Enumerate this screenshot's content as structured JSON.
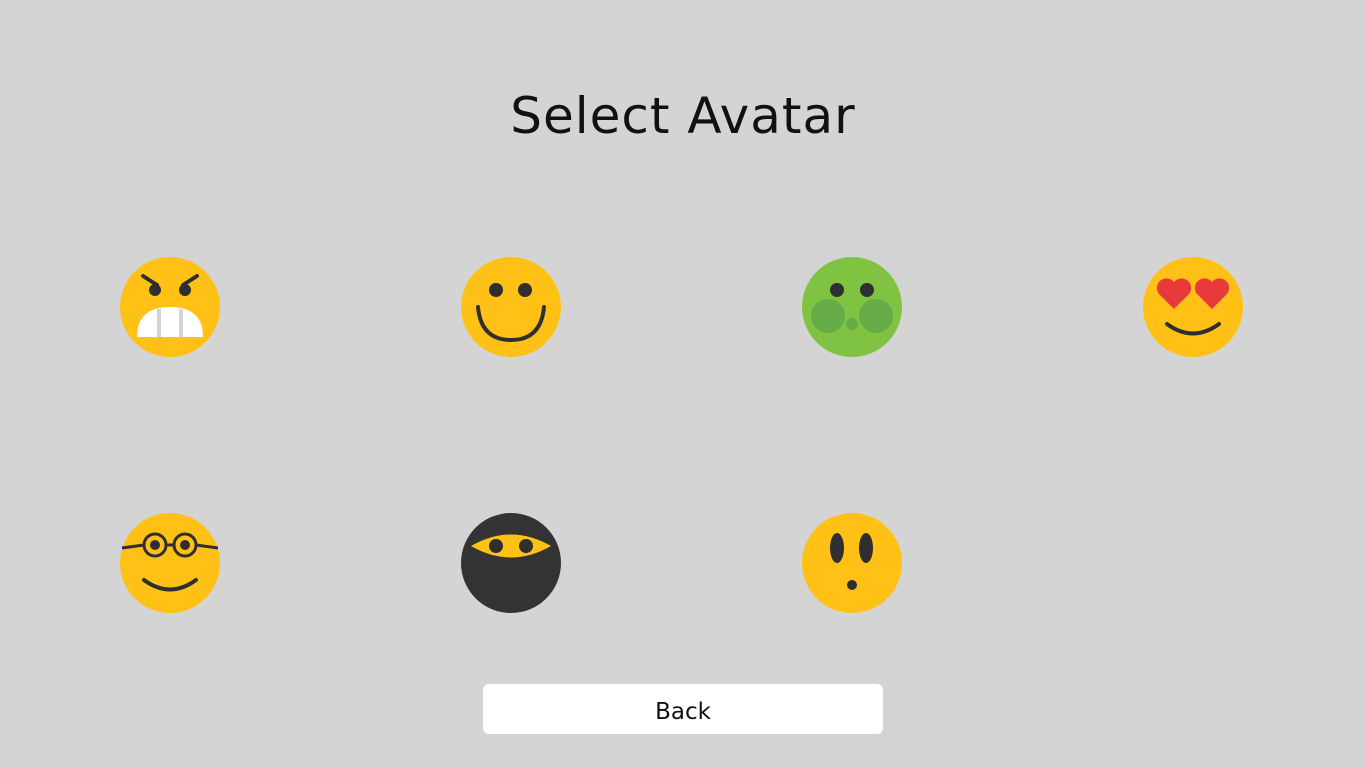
{
  "title": "Select Avatar",
  "back_label": "Back",
  "colors": {
    "background": "#d4d4d4",
    "face_yellow": "#ffc116",
    "face_green": "#80c342",
    "face_dark": "#333333",
    "feature_dark": "#2f2f2f",
    "heart_red": "#e83a3a",
    "button_bg": "#ffffff"
  },
  "avatars": [
    {
      "icon": "angry-face-icon"
    },
    {
      "icon": "smiling-face-icon"
    },
    {
      "icon": "green-sick-face-icon"
    },
    {
      "icon": "heart-eyes-face-icon"
    },
    {
      "icon": "nerd-glasses-face-icon"
    },
    {
      "icon": "ninja-face-icon"
    },
    {
      "icon": "surprised-face-icon"
    }
  ]
}
